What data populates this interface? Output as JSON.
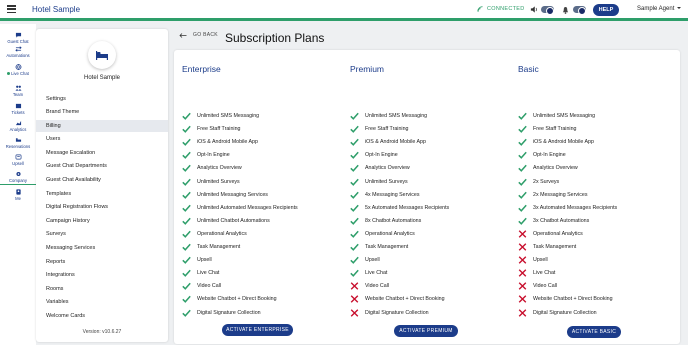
{
  "topbar": {
    "menu_icon": "hamburger-icon",
    "hotel_name": "Hotel Sample",
    "connection_status": "CONNECTED",
    "help_label": "HELP",
    "agent_name": "Sample Agent",
    "colors": {
      "accent": "#2e9e6a",
      "brand": "#1c3c8a"
    }
  },
  "icon_nav": [
    {
      "label": "Guest Chat",
      "icon": "chat-bubble-icon"
    },
    {
      "label": "Automations",
      "icon": "arrows-icon"
    },
    {
      "label": "Live Chat",
      "icon": "globe-icon"
    },
    {
      "label": "Team",
      "icon": "team-icon"
    },
    {
      "label": "Tickets",
      "icon": "tickets-icon"
    },
    {
      "label": "Analytics",
      "icon": "analytics-icon"
    },
    {
      "label": "Reservations",
      "icon": "bed-icon"
    },
    {
      "label": "Upsell",
      "icon": "upsell-icon"
    },
    {
      "label": "Company",
      "icon": "gear-icon"
    },
    {
      "label": "Me",
      "icon": "person-icon"
    }
  ],
  "settings_panel": {
    "hotel_name": "Hotel Sample",
    "menu": [
      "Settings",
      "Brand Theme",
      "Billing",
      "Users",
      "Message Escalation",
      "Guest Chat Departments",
      "Guest Chat Availability",
      "Templates",
      "Digital Registration Flows",
      "Campaign History",
      "Surveys",
      "Messaging Services",
      "Reports",
      "Integrations",
      "Rooms",
      "Variables",
      "Welcome Cards"
    ],
    "active_item": "Billing",
    "version": "Version: v10.6.27"
  },
  "main": {
    "back_label": "GO BACK",
    "title": "Subscription Plans",
    "plans": [
      {
        "name": "Enterprise",
        "button": "ACTIVATE ENTERPRISE",
        "features": [
          {
            "label": "Unlimited SMS Messaging",
            "included": true
          },
          {
            "label": "Free Staff Training",
            "included": true
          },
          {
            "label": "iOS & Android Mobile App",
            "included": true
          },
          {
            "label": "Opt-In Engine",
            "included": true
          },
          {
            "label": "Analytics Overview",
            "included": true
          },
          {
            "label": "Unlimited Surveys",
            "included": true
          },
          {
            "label": "Unlimited Messaging Services",
            "included": true
          },
          {
            "label": "Unlimited Automated Messages Recipients",
            "included": true
          },
          {
            "label": "Unlimited Chatbot Automations",
            "included": true
          },
          {
            "label": "Operational Analytics",
            "included": true
          },
          {
            "label": "Task Management",
            "included": true
          },
          {
            "label": "Upsell",
            "included": true
          },
          {
            "label": "Live Chat",
            "included": true
          },
          {
            "label": "Video Call",
            "included": true
          },
          {
            "label": "Website Chatbot + Direct Booking",
            "included": true
          },
          {
            "label": "Digital Signature Collection",
            "included": true
          }
        ]
      },
      {
        "name": "Premium",
        "button": "ACTIVATE PREMIUM",
        "features": [
          {
            "label": "Unlimited SMS Messaging",
            "included": true
          },
          {
            "label": "Free Staff Training",
            "included": true
          },
          {
            "label": "iOS & Android Mobile App",
            "included": true
          },
          {
            "label": "Opt-In Engine",
            "included": true
          },
          {
            "label": "Analytics Overview",
            "included": true
          },
          {
            "label": "Unlimited Surveys",
            "included": true
          },
          {
            "label": "4x Messaging Services",
            "included": true
          },
          {
            "label": "5x Automated Messages Recipients",
            "included": true
          },
          {
            "label": "8x Chatbot Automations",
            "included": true
          },
          {
            "label": "Operational Analytics",
            "included": true
          },
          {
            "label": "Task Management",
            "included": true
          },
          {
            "label": "Upsell",
            "included": true
          },
          {
            "label": "Live Chat",
            "included": true
          },
          {
            "label": "Video Call",
            "included": false
          },
          {
            "label": "Website Chatbot + Direct Booking",
            "included": false
          },
          {
            "label": "Digital Signature Collection",
            "included": false
          }
        ]
      },
      {
        "name": "Basic",
        "button": "ACTIVATE BASIC",
        "features": [
          {
            "label": "Unlimited SMS Messaging",
            "included": true
          },
          {
            "label": "Free Staff Training",
            "included": true
          },
          {
            "label": "iOS & Android Mobile App",
            "included": true
          },
          {
            "label": "Opt-In Engine",
            "included": true
          },
          {
            "label": "Analytics Overview",
            "included": true
          },
          {
            "label": "2x Surveys",
            "included": true
          },
          {
            "label": "2x Messaging Services",
            "included": true
          },
          {
            "label": "3x Automated Messages Recipients",
            "included": true
          },
          {
            "label": "3x Chatbot Automations",
            "included": true
          },
          {
            "label": "Operational Analytics",
            "included": false
          },
          {
            "label": "Task Management",
            "included": false
          },
          {
            "label": "Upsell",
            "included": false
          },
          {
            "label": "Live Chat",
            "included": false
          },
          {
            "label": "Video Call",
            "included": false
          },
          {
            "label": "Website Chatbot + Direct Booking",
            "included": false
          },
          {
            "label": "Digital Signature Collection",
            "included": false
          }
        ]
      }
    ],
    "colors": {
      "check": "#2e9e6a",
      "cross": "#c8102e",
      "button": "#1c3c8a"
    }
  }
}
